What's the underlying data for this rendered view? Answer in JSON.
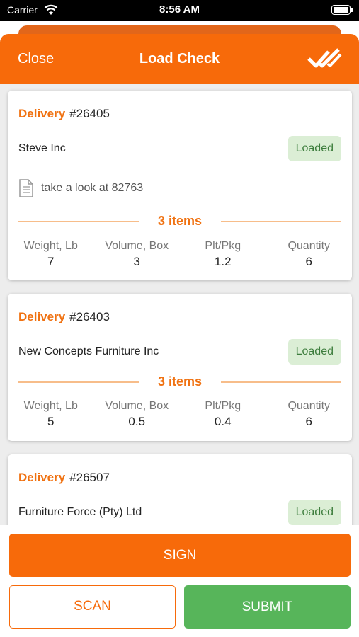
{
  "status_bar": {
    "carrier": "Carrier",
    "time": "8:56 AM"
  },
  "nav": {
    "close_label": "Close",
    "title": "Load Check",
    "action_icon": "double-check-icon"
  },
  "deliveries": [
    {
      "label": "Delivery",
      "number": "#26405",
      "customer": "Steve Inc",
      "status": "Loaded",
      "note": "take a look at 82763",
      "items": "3 items",
      "stats": [
        {
          "label": "Weight, Lb",
          "value": "7"
        },
        {
          "label": "Volume, Box",
          "value": "3"
        },
        {
          "label": "Plt/Pkg",
          "value": "1.2"
        },
        {
          "label": "Quantity",
          "value": "6"
        }
      ]
    },
    {
      "label": "Delivery",
      "number": "#26403",
      "customer": "New Concepts Furniture Inc",
      "status": "Loaded",
      "items": "3 items",
      "stats": [
        {
          "label": "Weight, Lb",
          "value": "5"
        },
        {
          "label": "Volume, Box",
          "value": "0.5"
        },
        {
          "label": "Plt/Pkg",
          "value": "0.4"
        },
        {
          "label": "Quantity",
          "value": "6"
        }
      ]
    },
    {
      "label": "Delivery",
      "number": "#26507",
      "customer": "Furniture Force (Pty) Ltd",
      "status": "Loaded"
    }
  ],
  "actions": {
    "sign_label": "SIGN",
    "scan_label": "SCAN",
    "submit_label": "SUBMIT"
  },
  "colors": {
    "accent": "#f76a0a",
    "success": "#57b55a",
    "badge_bg": "#dbeed5",
    "badge_text": "#3d7d3d"
  }
}
